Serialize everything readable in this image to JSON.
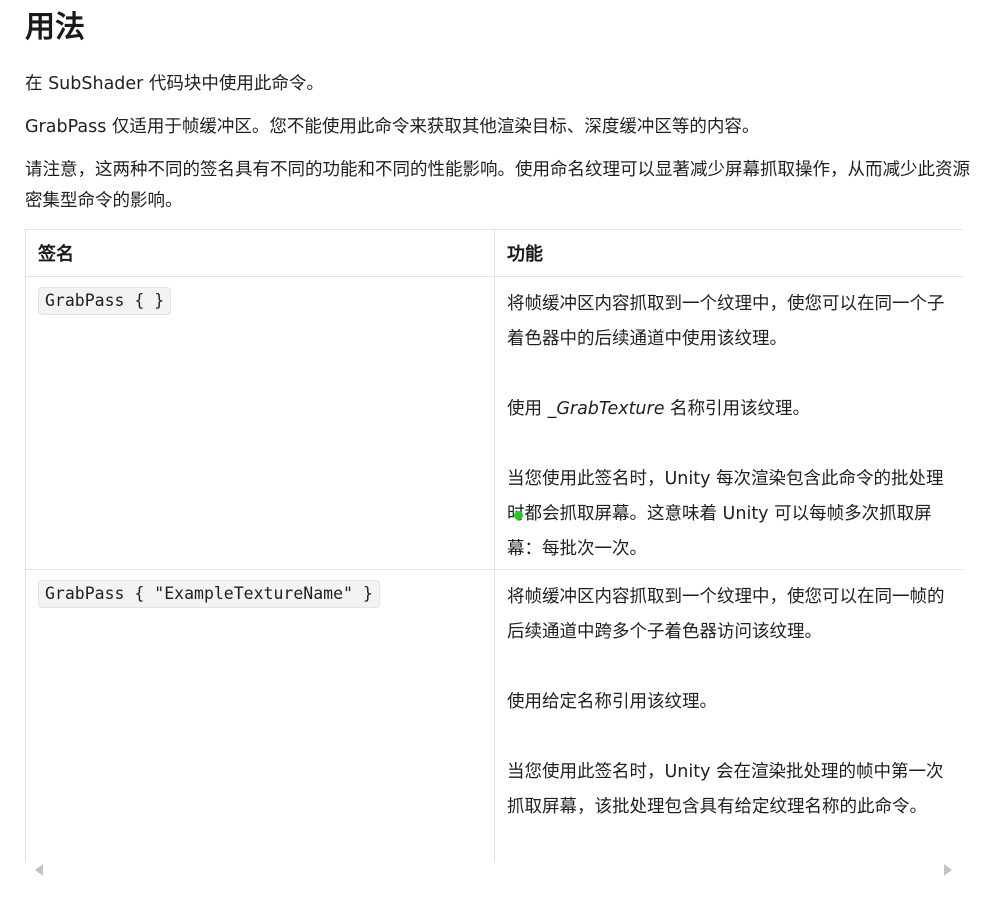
{
  "heading": "用法",
  "paragraphs": {
    "p1": "在 SubShader 代码块中使用此命令。",
    "p2": "GrabPass 仅适用于帧缓冲区。您不能使用此命令来获取其他渲染目标、深度缓冲区等的内容。",
    "p3": "请注意，这两种不同的签名具有不同的功能和不同的性能影响。使用命名纹理可以显著减少屏幕抓取操作，从而减少此资源密集型命令的影响。"
  },
  "table": {
    "headers": [
      "签名",
      "功能"
    ],
    "rows": [
      {
        "signature": "GrabPass { }",
        "desc1": "将帧缓冲区内容抓取到一个纹理中，使您可以在同一个子着色器中的后续通道中使用该纹理。",
        "desc2_prefix": "使用 ",
        "desc2_em": "_GrabTexture",
        "desc2_suffix": " 名称引用该纹理。",
        "desc3": "当您使用此签名时，Unity 每次渲染包含此命令的批处理时都会抓取屏幕。这意味着 Unity 可以每帧多次抓取屏幕：每批次一次。"
      },
      {
        "signature": "GrabPass { \"ExampleTextureName\" }",
        "desc1": "将帧缓冲区内容抓取到一个纹理中，使您可以在同一帧的后续通道中跨多个子着色器访问该纹理。",
        "desc2": "使用给定名称引用该纹理。",
        "desc3": "当您使用此签名时，Unity 会在渲染批处理的帧中第一次抓取屏幕，该批处理包含具有给定纹理名称的此命令。"
      }
    ]
  },
  "colors": {
    "text": "#1f1f1f",
    "border": "#e3e3e3",
    "code_bg": "#f3f3f3",
    "cursor_dot": "#22cc22"
  },
  "icons": {
    "scroll_left": "scroll-left-arrow-icon",
    "scroll_right": "scroll-right-arrow-icon"
  }
}
